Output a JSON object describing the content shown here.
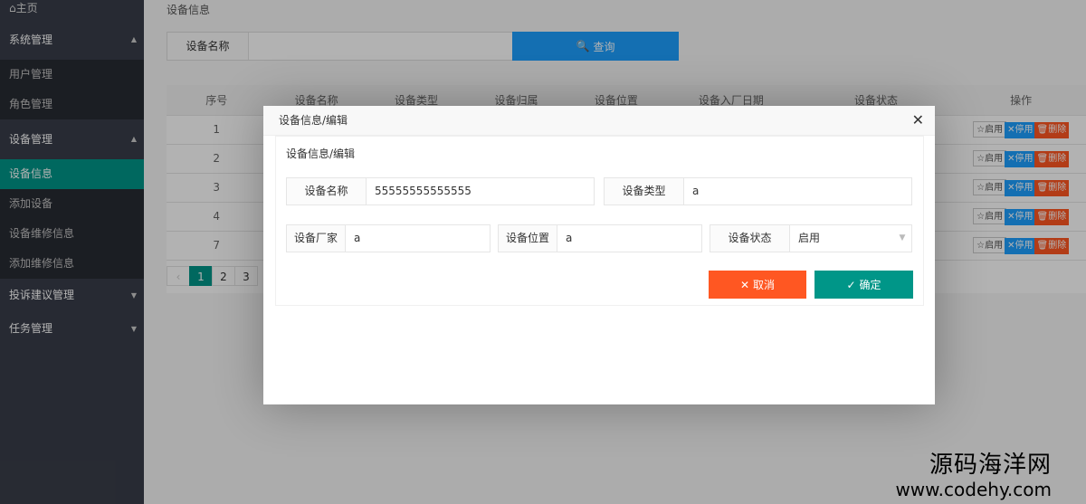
{
  "sidebar": {
    "home": "主页",
    "groups": [
      {
        "label": "系统管理",
        "items": [
          "用户管理",
          "角色管理"
        ]
      },
      {
        "label": "设备管理",
        "items": [
          "设备信息",
          "添加设备",
          "设备维修信息",
          "添加维修信息"
        ]
      },
      {
        "label": "投诉建议管理",
        "items": []
      },
      {
        "label": "任务管理",
        "items": []
      }
    ],
    "active_item": "设备信息"
  },
  "main": {
    "breadcrumb": "设备信息",
    "search": {
      "label": "设备名称",
      "value": "",
      "button": "查询"
    },
    "table": {
      "headers": [
        "序号",
        "设备名称",
        "设备类型",
        "设备归属",
        "设备位置",
        "设备入厂日期",
        "设备状态",
        "操作"
      ],
      "rows": [
        "1",
        "2",
        "3",
        "4",
        "7"
      ],
      "actions": {
        "enable": "启用",
        "disable": "停用",
        "delete": "删除"
      }
    },
    "pager": [
      "1",
      "2",
      "3"
    ],
    "current_page": "1"
  },
  "modal": {
    "title": "设备信息/编辑",
    "section_title": "设备信息/编辑",
    "fields": {
      "name": {
        "label": "设备名称",
        "value": "55555555555555"
      },
      "type": {
        "label": "设备类型",
        "value": "a"
      },
      "vendor": {
        "label": "设备厂家",
        "value": "a"
      },
      "location": {
        "label": "设备位置",
        "value": "a"
      },
      "status": {
        "label": "设备状态",
        "value": "启用"
      }
    },
    "cancel": "取消",
    "confirm": "确定"
  },
  "watermark": {
    "line1": "源码海洋网",
    "line2": "www.codehy.com"
  },
  "colors": {
    "sidebar": "#393d49",
    "teal": "#009688",
    "blue": "#1e9fff",
    "orange": "#ff5722"
  }
}
